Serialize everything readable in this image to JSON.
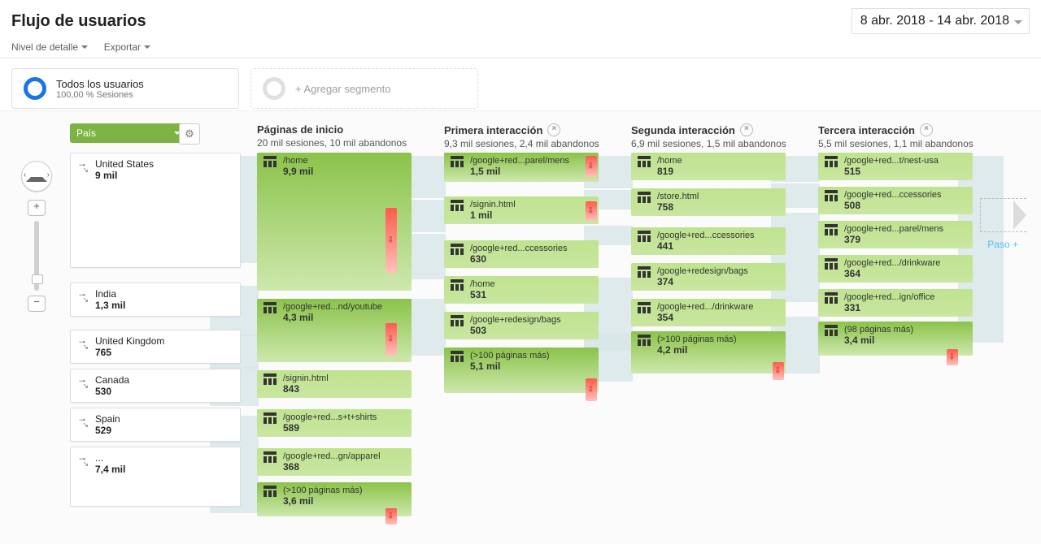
{
  "header": {
    "title": "Flujo de usuarios"
  },
  "date_range": "8 abr. 2018 - 14 abr. 2018",
  "toolbar": {
    "detail": "Nivel de detalle",
    "export": "Exportar"
  },
  "segments": {
    "all_title": "Todos los usuarios",
    "all_sub": "100,00 % Sesiones",
    "add": "+ Agregar segmento"
  },
  "dimension_selector": "País",
  "paso_label": "Paso +",
  "source": {
    "items": [
      {
        "label": "United States",
        "value": "9 mil"
      },
      {
        "label": "India",
        "value": "1,3 mil"
      },
      {
        "label": "United Kingdom",
        "value": "765"
      },
      {
        "label": "Canada",
        "value": "530"
      },
      {
        "label": "Spain",
        "value": "529"
      },
      {
        "label": "...",
        "value": "7,4 mil"
      }
    ]
  },
  "columns": [
    {
      "title": "Páginas de inicio",
      "sub": "20 mil sesiones, 10 mil abandonos",
      "closable": false,
      "nodes": [
        {
          "label": "/home",
          "value": "9,9 mil"
        },
        {
          "label": "/google+red...nd/youtube",
          "value": "4,3 mil"
        },
        {
          "label": "/signin.html",
          "value": "843"
        },
        {
          "label": "/google+red...s+t+shirts",
          "value": "589"
        },
        {
          "label": "/google+red...gn/apparel",
          "value": "368"
        },
        {
          "label": "(>100 páginas más)",
          "value": "3,6 mil"
        }
      ]
    },
    {
      "title": "Primera interacción",
      "sub": "9,3 mil sesiones, 2,4 mil abandonos",
      "closable": true,
      "nodes": [
        {
          "label": "/google+red...parel/mens",
          "value": "1,5 mil"
        },
        {
          "label": "/signin.html",
          "value": "1 mil"
        },
        {
          "label": "/google+red...ccessories",
          "value": "630"
        },
        {
          "label": "/home",
          "value": "531"
        },
        {
          "label": "/google+redesign/bags",
          "value": "503"
        },
        {
          "label": "(>100 páginas más)",
          "value": "5,1 mil"
        }
      ]
    },
    {
      "title": "Segunda interacción",
      "sub": "6,9 mil sesiones, 1,5 mil abandonos",
      "closable": true,
      "nodes": [
        {
          "label": "/home",
          "value": "819"
        },
        {
          "label": "/store.html",
          "value": "758"
        },
        {
          "label": "/google+red...ccessories",
          "value": "441"
        },
        {
          "label": "/google+redesign/bags",
          "value": "374"
        },
        {
          "label": "/google+red.../drinkware",
          "value": "354"
        },
        {
          "label": "(>100 páginas más)",
          "value": "4,2 mil"
        }
      ]
    },
    {
      "title": "Tercera interacción",
      "sub": "5,5 mil sesiones, 1,1 mil abandonos",
      "closable": true,
      "nodes": [
        {
          "label": "/google+red...t/nest-usa",
          "value": "515"
        },
        {
          "label": "/google+red...ccessories",
          "value": "508"
        },
        {
          "label": "/google+red...parel/mens",
          "value": "379"
        },
        {
          "label": "/google+red.../drinkware",
          "value": "364"
        },
        {
          "label": "/google+red...ign/office",
          "value": "331"
        },
        {
          "label": "(98 páginas más)",
          "value": "3,4 mil"
        }
      ]
    }
  ]
}
